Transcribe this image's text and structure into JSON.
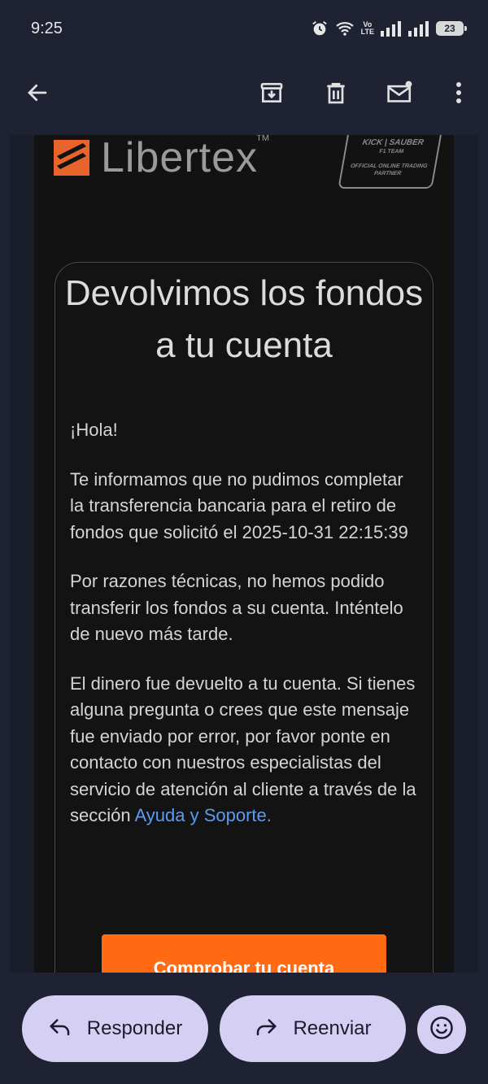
{
  "status_bar": {
    "time": "9:25",
    "volte_label": "Vo\nLTE",
    "battery_level": "23"
  },
  "toolbar": {
    "back_icon": "arrow-left-icon",
    "archive_icon": "archive-icon",
    "delete_icon": "trash-icon",
    "mark_unread_icon": "mail-unread-icon",
    "more_icon": "more-vert-icon"
  },
  "email": {
    "brand_name": "Libertex",
    "brand_tm": "TM",
    "sponsor_line1": "KICK | SAUBER",
    "sponsor_line2": "F1 TEAM",
    "sponsor_line3": "OFFICIAL ONLINE TRADING PARTNER",
    "title": "Devolvimos los fondos a tu cuenta",
    "greeting": "¡Hola!",
    "paragraph1": "Te informamos que no pudimos completar la transferencia bancaria para el retiro de fondos que solicitó el 2025-10-31 22:15:39",
    "paragraph2": "Por razones técnicas, no hemos podido transferir los fondos a su cuenta. Inténtelo de nuevo más tarde.",
    "paragraph3_text": "El dinero fue devuelto a tu cuenta. Si tienes alguna pregunta o crees que este mensaje fue enviado por error, por favor ponte en contacto con nuestros especialistas del servicio de atención al cliente a través de la sección ",
    "paragraph3_link": "Ayuda y Soporte.",
    "cta_label": "Comprobar tu cuenta"
  },
  "bottom_bar": {
    "reply_label": "Responder",
    "forward_label": "Reenviar",
    "emoji_icon": "emoji-smile-icon"
  },
  "colors": {
    "accent_orange": "#ff6a13",
    "pill_bg": "#d5d0f3",
    "link_blue": "#5b9cf0"
  }
}
